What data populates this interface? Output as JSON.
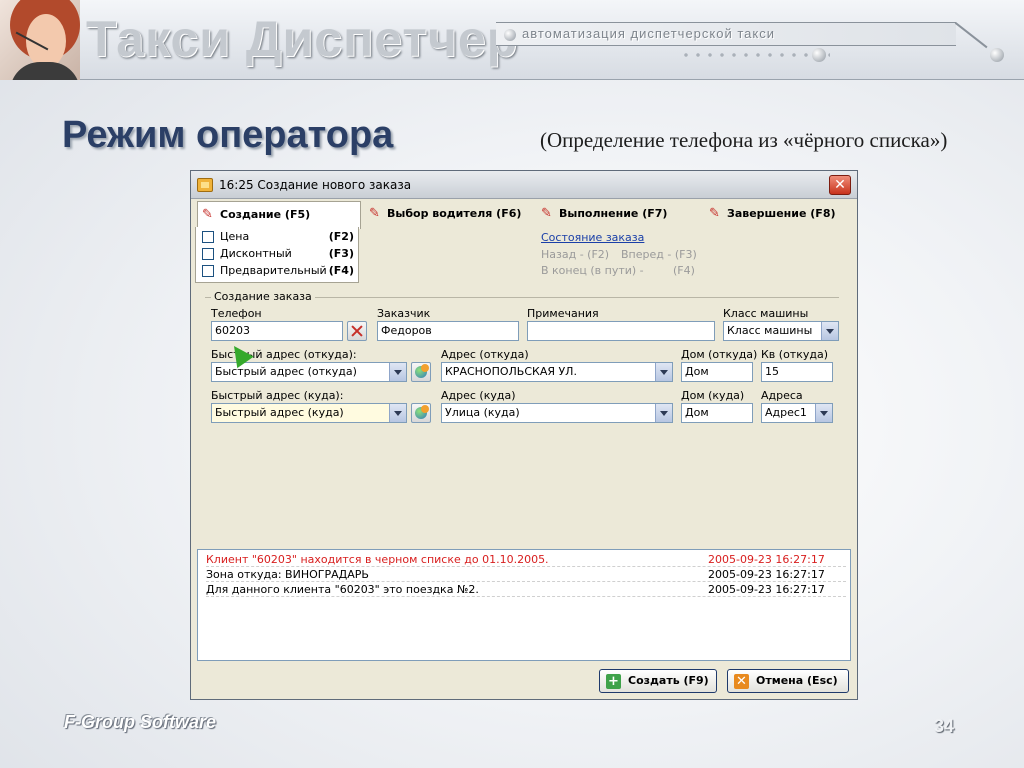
{
  "header": {
    "title": "Такси Диспетчер",
    "subtitle": "автоматизация диспетчерской такси"
  },
  "slide": {
    "title": "Режим оператора",
    "subtitle": "(Определение телефона из «чёрного списка»)"
  },
  "window": {
    "caption": "16:25 Создание нового заказа",
    "close_symbol": "✕",
    "tabs": [
      {
        "label": "Создание (F5)",
        "icon": "pencil-icon"
      },
      {
        "label": "Выбор водителя (F6)",
        "icon": "pencil-icon"
      },
      {
        "label": "Выполнение (F7)",
        "icon": "pencil-icon"
      },
      {
        "label": "Завершение (F8)",
        "icon": "pencil-icon"
      }
    ],
    "options": [
      {
        "label": "Цена",
        "key": "(F2)",
        "checked": false
      },
      {
        "label": "Дисконтный",
        "key": "(F3)",
        "checked": false
      },
      {
        "label": "Предварительный",
        "key": "(F4)",
        "checked": false
      }
    ],
    "status": {
      "link": "Состояние заказа",
      "back": "Назад - (F2)",
      "forward": "Вперед - (F3)",
      "end": "В конец (в пути) -",
      "end_key": "(F4)"
    }
  },
  "form": {
    "group_label": "Создание заказа",
    "phone": {
      "label": "Телефон",
      "value": "60203"
    },
    "customer": {
      "label": "Заказчик",
      "value": "Федоров"
    },
    "notes": {
      "label": "Примечания",
      "value": ""
    },
    "car_class": {
      "label": "Класс машины",
      "value": "Класс машины"
    },
    "quick_from": {
      "label": "Быстрый адрес (откуда):",
      "value": "Быстрый адрес (откуда)"
    },
    "address_from": {
      "label": "Адрес (откуда)",
      "value": "КРАСНОПОЛЬСКАЯ УЛ."
    },
    "house_from": {
      "label": "Дом (откуда)",
      "value": "Дом"
    },
    "apt_from": {
      "label": "Кв (откуда)",
      "value": "15"
    },
    "quick_to": {
      "label": "Быстрый адрес (куда):",
      "value": "Быстрый адрес (куда)"
    },
    "address_to": {
      "label": "Адрес (куда)",
      "value": "Улица (куда)"
    },
    "house_to": {
      "label": "Дом (куда)",
      "value": "Дом"
    },
    "addresses": {
      "label": "Адреса",
      "value": "Адрес1"
    }
  },
  "log": [
    {
      "message": "Клиент \"60203\" находится в черном списке до 01.10.2005.",
      "time": "2005-09-23 16:27:17",
      "color": "#d81e1e"
    },
    {
      "message": "Зона откуда: ВИНОГРАДАРЬ",
      "time": "2005-09-23 16:27:17",
      "color": "#000000"
    },
    {
      "message": "Для данного клиента \"60203\" это поездка №2.",
      "time": "2005-09-23 16:27:17",
      "color": "#000000"
    }
  ],
  "buttons": {
    "create": "Создать (F9)",
    "create_icon": "+",
    "cancel": "Отмена (Esc)",
    "cancel_icon": "✕"
  },
  "footer": {
    "company": "F-Group Software",
    "page": "34"
  }
}
